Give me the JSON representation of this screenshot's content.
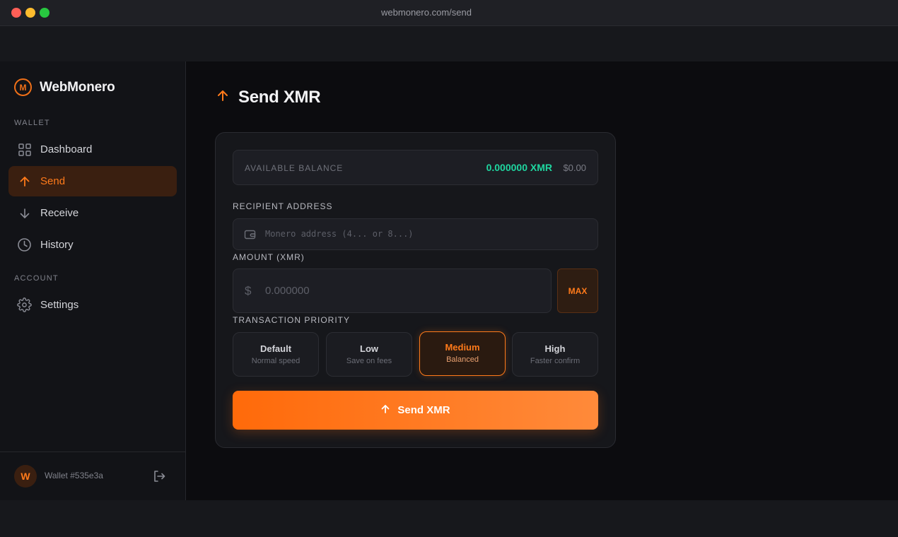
{
  "browser": {
    "url": "webmonero.com/send"
  },
  "brand": {
    "logo_letter": "M",
    "name": "WebMonero"
  },
  "sidebar": {
    "section_wallet": "WALLET",
    "section_account": "ACCOUNT",
    "items": [
      {
        "label": "Dashboard",
        "icon": "grid-icon"
      },
      {
        "label": "Send",
        "icon": "arrow-up-icon",
        "active": true
      },
      {
        "label": "Receive",
        "icon": "arrow-down-icon"
      },
      {
        "label": "History",
        "icon": "clock-icon"
      },
      {
        "label": "Settings",
        "icon": "gear-icon"
      }
    ],
    "footer": {
      "avatar_letter": "W",
      "wallet_id": "Wallet #535e3a",
      "logout_icon": "logout-icon"
    }
  },
  "page": {
    "title": "Send XMR"
  },
  "form": {
    "balance_label": "AVAILABLE BALANCE",
    "balance_xmr": "0.000000 XMR",
    "balance_usd": "$0.00",
    "recipient_label": "RECIPIENT ADDRESS",
    "recipient_placeholder": "Monero address (4... or 8...)",
    "amount_label": "AMOUNT (XMR)",
    "amount_currency_symbol": "$",
    "amount_placeholder": "0.000000",
    "max_label": "MAX",
    "priority_label": "TRANSACTION PRIORITY",
    "priorities": [
      {
        "title": "Default",
        "subtitle": "Normal speed"
      },
      {
        "title": "Low",
        "subtitle": "Save on fees"
      },
      {
        "title": "Medium",
        "subtitle": "Balanced",
        "selected": true
      },
      {
        "title": "High",
        "subtitle": "Faster confirm"
      }
    ],
    "submit_label": "Send XMR"
  },
  "colors": {
    "accent": "#ff7a1a",
    "balance": "#1fd6a0",
    "background": "#0c0c0f"
  }
}
